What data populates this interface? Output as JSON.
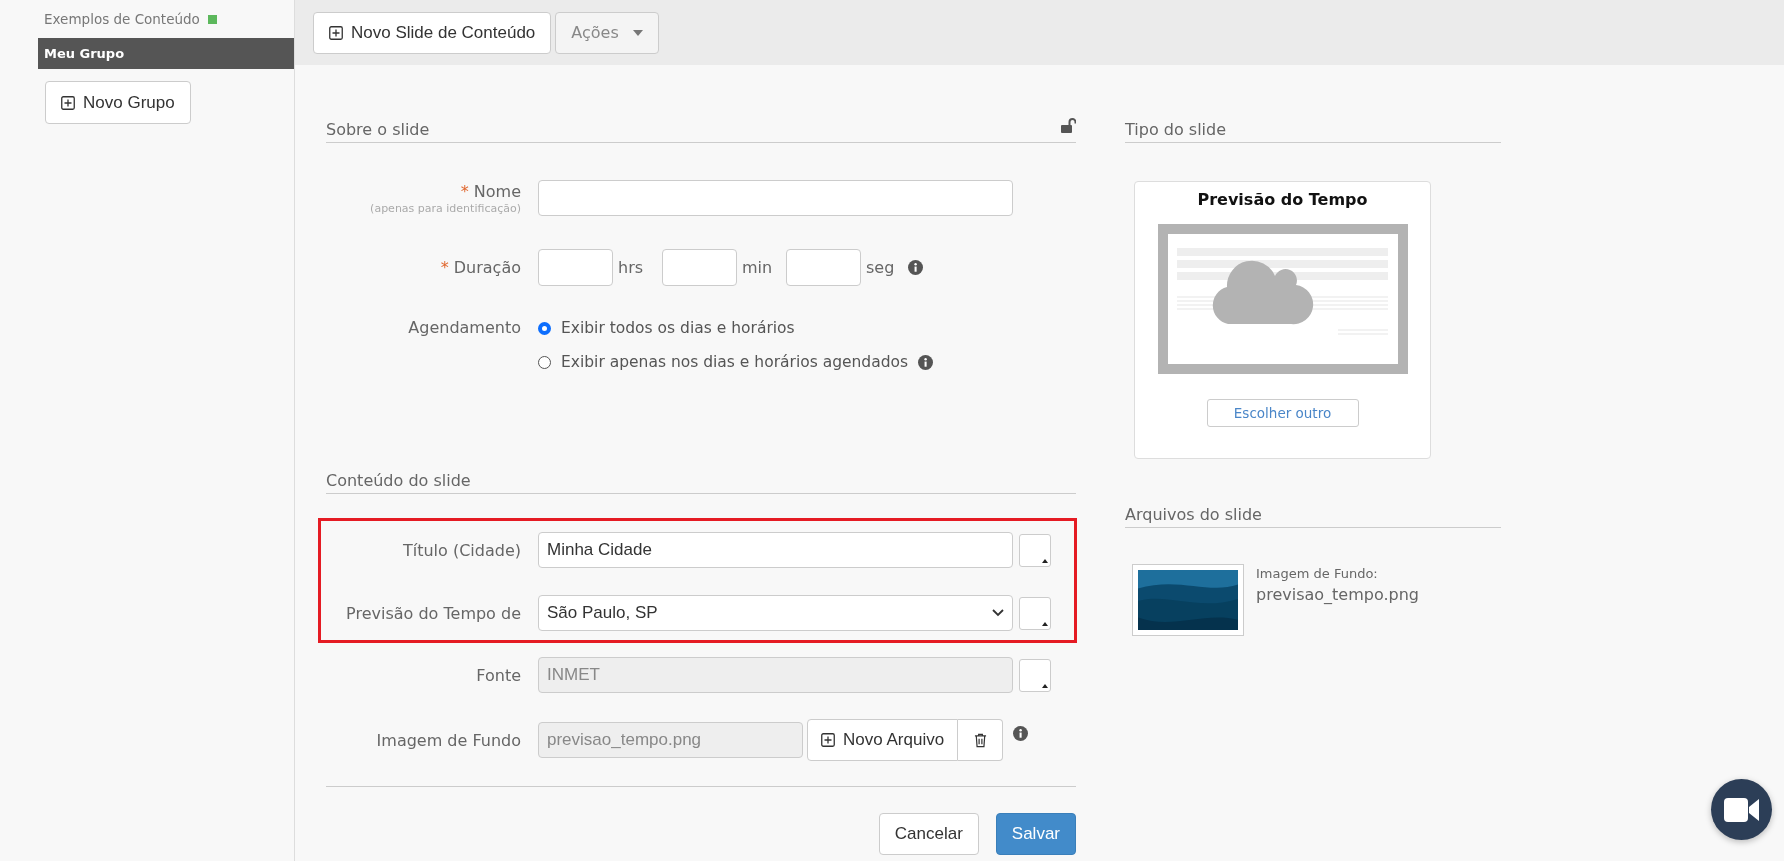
{
  "sidebar": {
    "items": [
      {
        "label": "Exemplos de Conteúdo",
        "color": "#5cb85c",
        "selected": false
      },
      {
        "label": "Meu Grupo",
        "selected": true
      }
    ],
    "new_group_button": "Novo Grupo"
  },
  "toolbar": {
    "new_slide_button": "Novo Slide de Conteúdo",
    "actions_button": "Ações"
  },
  "about": {
    "title": "Sobre o slide",
    "locked": false,
    "name": {
      "required_mark": "*",
      "label": "Nome",
      "hint": "(apenas para identificação)"
    },
    "duration": {
      "required_mark": "*",
      "label": "Duração",
      "units": [
        "hrs",
        "min",
        "seg"
      ]
    },
    "schedule": {
      "label": "Agendamento",
      "options": [
        {
          "label": "Exibir todos os dias e horários",
          "selected": true,
          "info": false
        },
        {
          "label": "Exibir apenas nos dias e horários agendados",
          "selected": false,
          "info": true
        }
      ]
    }
  },
  "content": {
    "title": "Conteúdo do slide",
    "highlighted": [
      {
        "kind": "text",
        "label": "Título (Cidade)",
        "value": "Minha Cidade"
      },
      {
        "kind": "select",
        "label": "Previsão do Tempo de",
        "value": "São Paulo, SP"
      }
    ],
    "fields": [
      {
        "kind": "disabled",
        "label": "Fonte",
        "value": "INMET"
      },
      {
        "kind": "file",
        "label": "Imagem de Fundo",
        "value": "previsao_tempo.png",
        "button": "Novo Arquivo"
      }
    ]
  },
  "footer": {
    "cancel": "Cancelar",
    "save": "Salvar"
  },
  "slide_type": {
    "title": "Tipo do slide",
    "name": "Previsão do Tempo",
    "change_button": "Escolher outro"
  },
  "files": {
    "title": "Arquivos do slide",
    "items": [
      {
        "label": "Imagem de Fundo:",
        "filename": "previsao_tempo.png"
      }
    ]
  }
}
